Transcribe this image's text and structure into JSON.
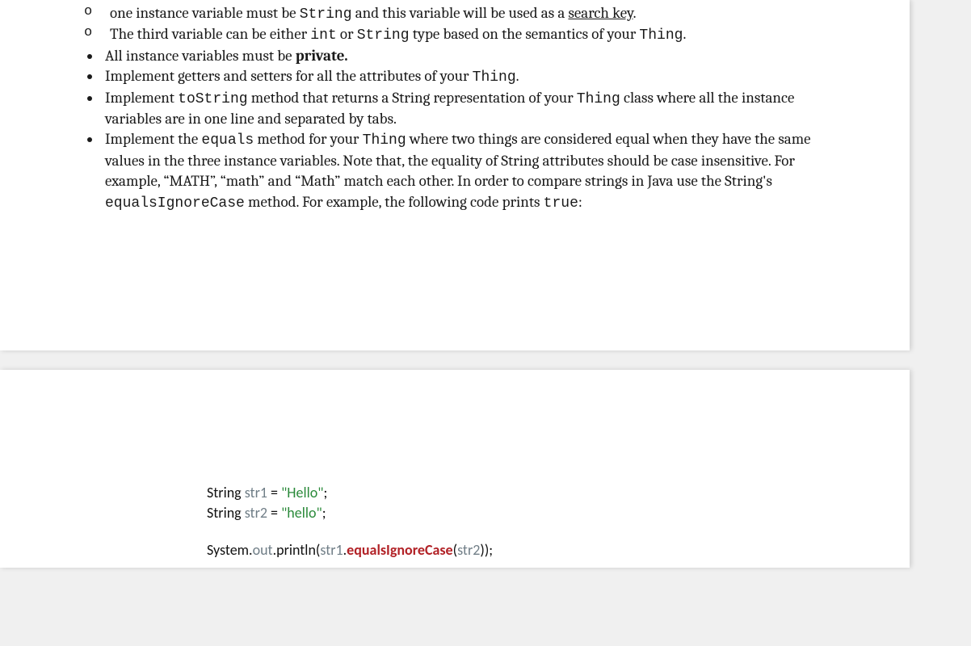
{
  "page1": {
    "sub_items": [
      {
        "pre": "one instance variable must be ",
        "code1": "String",
        "mid": " and this variable will be used as a ",
        "search_key": "search key",
        "post": "."
      },
      {
        "pre": "The third variable can be either ",
        "code1": "int",
        "mid1": " or ",
        "code2": "String",
        "mid2": " type based on the semantics of your ",
        "code3": "Thing",
        "post": "."
      }
    ],
    "bullets": {
      "b1_pre": "All instance variables must be ",
      "b1_bold": "private.",
      "b2_pre": "Implement getters and setters for all the attributes of your ",
      "b2_code": "Thing",
      "b2_post": ".",
      "b3_pre": "Implement ",
      "b3_code1": "toString",
      "b3_mid": " method that returns a String representation of your ",
      "b3_code2": "Thing",
      "b3_post": " class where all the instance variables are in one line and separated by tabs.",
      "b4_pre": "Implement the ",
      "b4_code1": "equals",
      "b4_mid1": " method for your ",
      "b4_code2": "Thing",
      "b4_mid2": " where two things are considered equal when they have the same values in the three instance variables. Note that, the equality of String attributes should be case insensitive. For example, “MATH”, “math” and “Math” match each other. In order to compare strings in Java use the String's ",
      "b4_code3": "equalsIgnoreCase",
      "b4_mid3": " method. For example, the following code prints ",
      "b4_code4": "true",
      "b4_post": ":"
    }
  },
  "page2": {
    "code": {
      "l1_kw": "String ",
      "l1_var": "str1",
      "l1_eq": " = ",
      "l1_str": "\"Hello\"",
      "l1_end": ";",
      "l2_kw": "String ",
      "l2_var": "str2",
      "l2_eq": " = ",
      "l2_str": "\"hello\"",
      "l2_end": ";",
      "l3_sys": "System",
      "l3_dot1": ".",
      "l3_out": "out",
      "l3_dot2": ".",
      "l3_println": "println(",
      "l3_var1": "str1",
      "l3_dot3": ".",
      "l3_meth": "equalsIgnoreCase",
      "l3_open": "(",
      "l3_var2": "str2",
      "l3_close": "));"
    }
  }
}
